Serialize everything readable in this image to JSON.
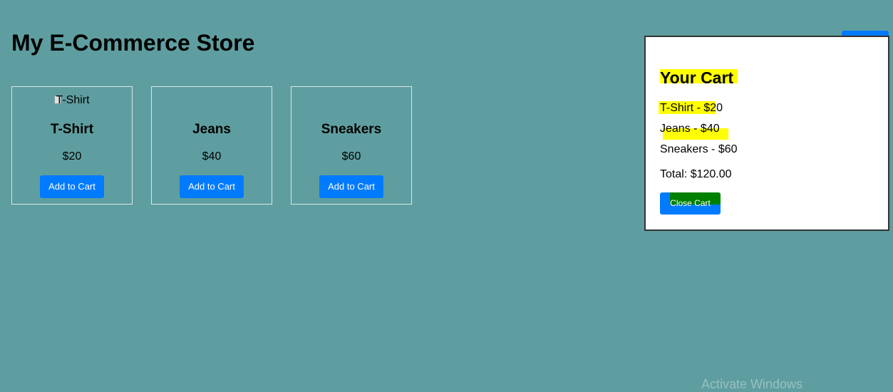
{
  "store": {
    "title": "My E-Commerce Store"
  },
  "products": [
    {
      "image_alt": "T-Shirt",
      "name": "T-Shirt",
      "price": "$20",
      "button_label": "Add to Cart"
    },
    {
      "name": "Jeans",
      "price": "$40",
      "button_label": "Add to Cart"
    },
    {
      "name": "Sneakers",
      "price": "$60",
      "button_label": "Add to Cart"
    }
  ],
  "cart": {
    "title": "Your Cart",
    "items": [
      "T-Shirt - $20",
      "Jeans - $40",
      "Sneakers - $60"
    ],
    "total": "Total: $120.00",
    "close_label": "Close Cart"
  },
  "watermark": {
    "text": "Activate Windows"
  },
  "colors": {
    "background": "#5f9ea0",
    "button": "#007bff",
    "highlight": "#ffff00",
    "close_mark": "#008000"
  },
  "icons": {
    "broken_image": "broken-image-icon"
  }
}
